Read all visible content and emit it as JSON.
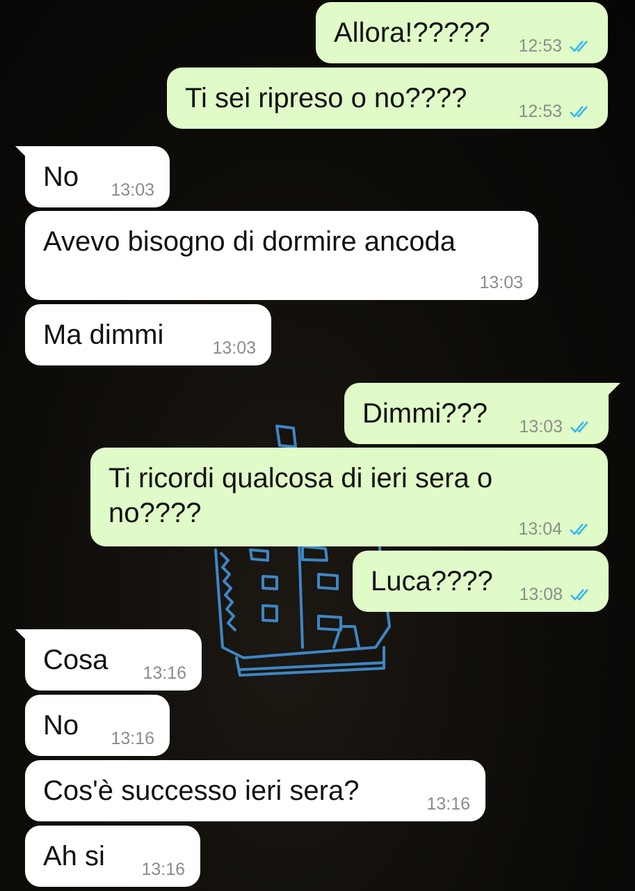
{
  "colors": {
    "outgoing_bubble": "#e0fac8",
    "incoming_bubble": "#ffffff",
    "read_ticks": "#34b7f1",
    "wallpaper": "#0b0a08"
  },
  "messages": [
    {
      "direction": "outgoing",
      "text": "Allora!?????",
      "time": "12:53",
      "status": "read"
    },
    {
      "direction": "outgoing",
      "text": "Ti sei ripreso o no????",
      "time": "12:53",
      "status": "read"
    },
    {
      "direction": "incoming",
      "text": "No",
      "time": "13:03"
    },
    {
      "direction": "incoming",
      "text": "Avevo bisogno di dormire ancoda",
      "time": "13:03"
    },
    {
      "direction": "incoming",
      "text": "Ma dimmi",
      "time": "13:03"
    },
    {
      "direction": "outgoing",
      "text": "Dimmi???",
      "time": "13:03",
      "status": "read"
    },
    {
      "direction": "outgoing",
      "text_line1": "Ti ricordi qualcosa di ieri sera o",
      "text_line2": "no????",
      "time": "13:04",
      "status": "read"
    },
    {
      "direction": "outgoing",
      "text": "Luca????",
      "time": "13:08",
      "status": "read"
    },
    {
      "direction": "incoming",
      "text": "Cosa",
      "time": "13:16"
    },
    {
      "direction": "incoming",
      "text": "No",
      "time": "13:16"
    },
    {
      "direction": "incoming",
      "text": "Cos'è successo ieri sera?",
      "time": "13:16"
    },
    {
      "direction": "incoming",
      "text": "Ah si",
      "time": "13:16"
    }
  ]
}
